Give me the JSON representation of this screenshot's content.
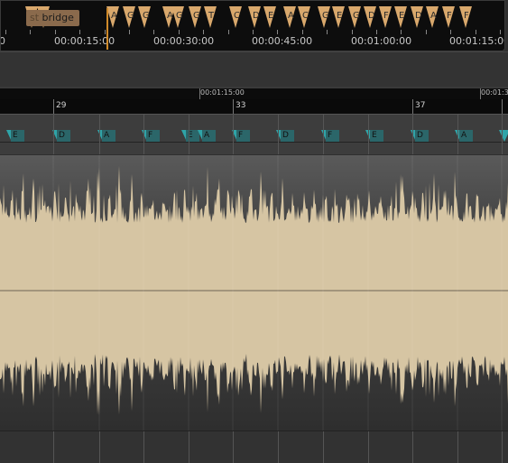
{
  "overview": {
    "section_chip": {
      "prefix": "st",
      "label": "bridge"
    },
    "chord_markers": [
      "A",
      "G",
      "G",
      "A",
      "G",
      "G",
      "T",
      "C",
      "D",
      "E",
      "A",
      "C",
      "G",
      "E",
      "G",
      "D",
      "F",
      "E",
      "D",
      "A",
      "F",
      "F"
    ],
    "ruler_ticks": [
      "0",
      "00:00:15:00",
      "00:00:30:00",
      "00:00:45:00",
      "00:01:00:00",
      "00:01:15:00"
    ]
  },
  "timeline": {
    "time_labels": [
      "00:01:15:00",
      "00:01:3"
    ],
    "bar_numbers": [
      "29",
      "33",
      "37"
    ]
  },
  "chord_lane": {
    "chords": [
      "E",
      "D",
      "A",
      "F",
      "E",
      "A",
      "F",
      "D",
      "F",
      "E",
      "D",
      "A"
    ]
  },
  "colors": {
    "waveform_fill": "#d6c5a3",
    "waveform_background": "#3a3a3a",
    "chord_marker": "#2fa4a8",
    "overview_marker": "#d9a86c",
    "playhead": "#d08a2a"
  }
}
